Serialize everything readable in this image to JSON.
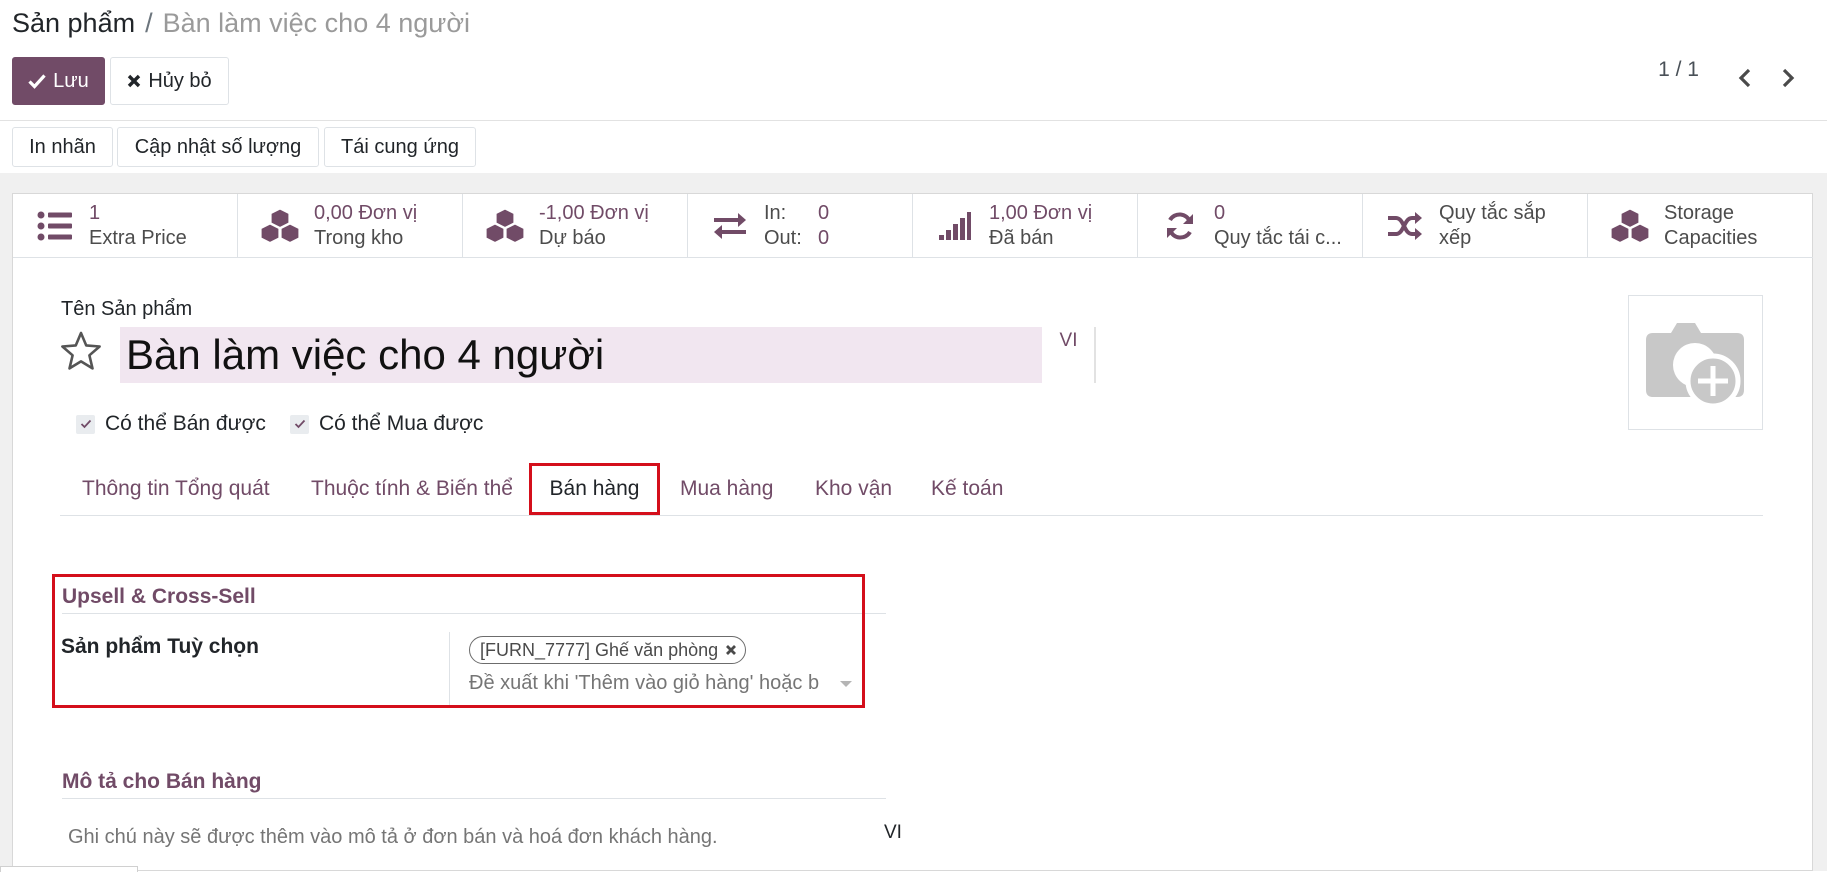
{
  "breadcrumb": {
    "parent": "Sản phẩm",
    "separator": "/",
    "current": "Bàn làm việc cho 4 người"
  },
  "control_panel": {
    "save_label": "Lưu",
    "discard_label": "Hủy bỏ",
    "pager_text": "1 / 1"
  },
  "action_buttons": [
    {
      "label": "In nhãn"
    },
    {
      "label": "Cập nhật số lượng"
    },
    {
      "label": "Tái cung ứng"
    }
  ],
  "stat_buttons": [
    {
      "icon": "list-icon",
      "value": "1",
      "label": "Extra Price"
    },
    {
      "icon": "cubes-icon",
      "value": "0,00 Đơn vị",
      "label": "Trong kho"
    },
    {
      "icon": "cubes-icon",
      "value": "-1,00 Đơn vị",
      "label": "Dự báo"
    },
    {
      "icon": "exchange-icon",
      "in_label": "In:",
      "in_value": "0",
      "out_label": "Out:",
      "out_value": "0"
    },
    {
      "icon": "signal-icon",
      "value": "1,00 Đơn vị",
      "label": "Đã bán"
    },
    {
      "icon": "refresh-icon",
      "value": "0",
      "label": "Quy tắc tái c..."
    },
    {
      "icon": "random-icon",
      "line1": "Quy tắc sắp",
      "line2": "xếp"
    },
    {
      "icon": "cubes-icon",
      "line1": "Storage",
      "line2": "Capacities"
    }
  ],
  "product": {
    "name_label": "Tên Sản phẩm",
    "name": "Bàn làm việc cho 4 người",
    "lang": "VI",
    "can_be_sold": {
      "label": "Có thể Bán được",
      "checked": true
    },
    "can_be_purchased": {
      "label": "Có thể Mua được",
      "checked": true
    }
  },
  "tabs": [
    {
      "label": "Thông tin Tổng quát"
    },
    {
      "label": "Thuộc tính & Biến thể"
    },
    {
      "label": "Bán hàng",
      "active": true
    },
    {
      "label": "Mua hàng"
    },
    {
      "label": "Kho vận"
    },
    {
      "label": "Kế toán"
    }
  ],
  "upsell_section": {
    "title": "Upsell & Cross-Sell",
    "optional_products_label": "Sản phẩm Tuỳ chọn",
    "tags": [
      {
        "label": "[FURN_7777] Ghế văn phòng"
      }
    ],
    "placeholder": "Đề xuất khi 'Thêm vào giỏ hàng' hoặc b"
  },
  "sales_description_section": {
    "title": "Mô tả cho Bán hàng",
    "placeholder": "Ghi chú này sẽ được thêm vào mô tả ở đơn bán và hoá đơn khách hàng.",
    "lang": "VI"
  },
  "colors": {
    "brand": "#714b67",
    "highlight_border": "#d40f1b",
    "name_field_bg": "#f1e6f0"
  }
}
